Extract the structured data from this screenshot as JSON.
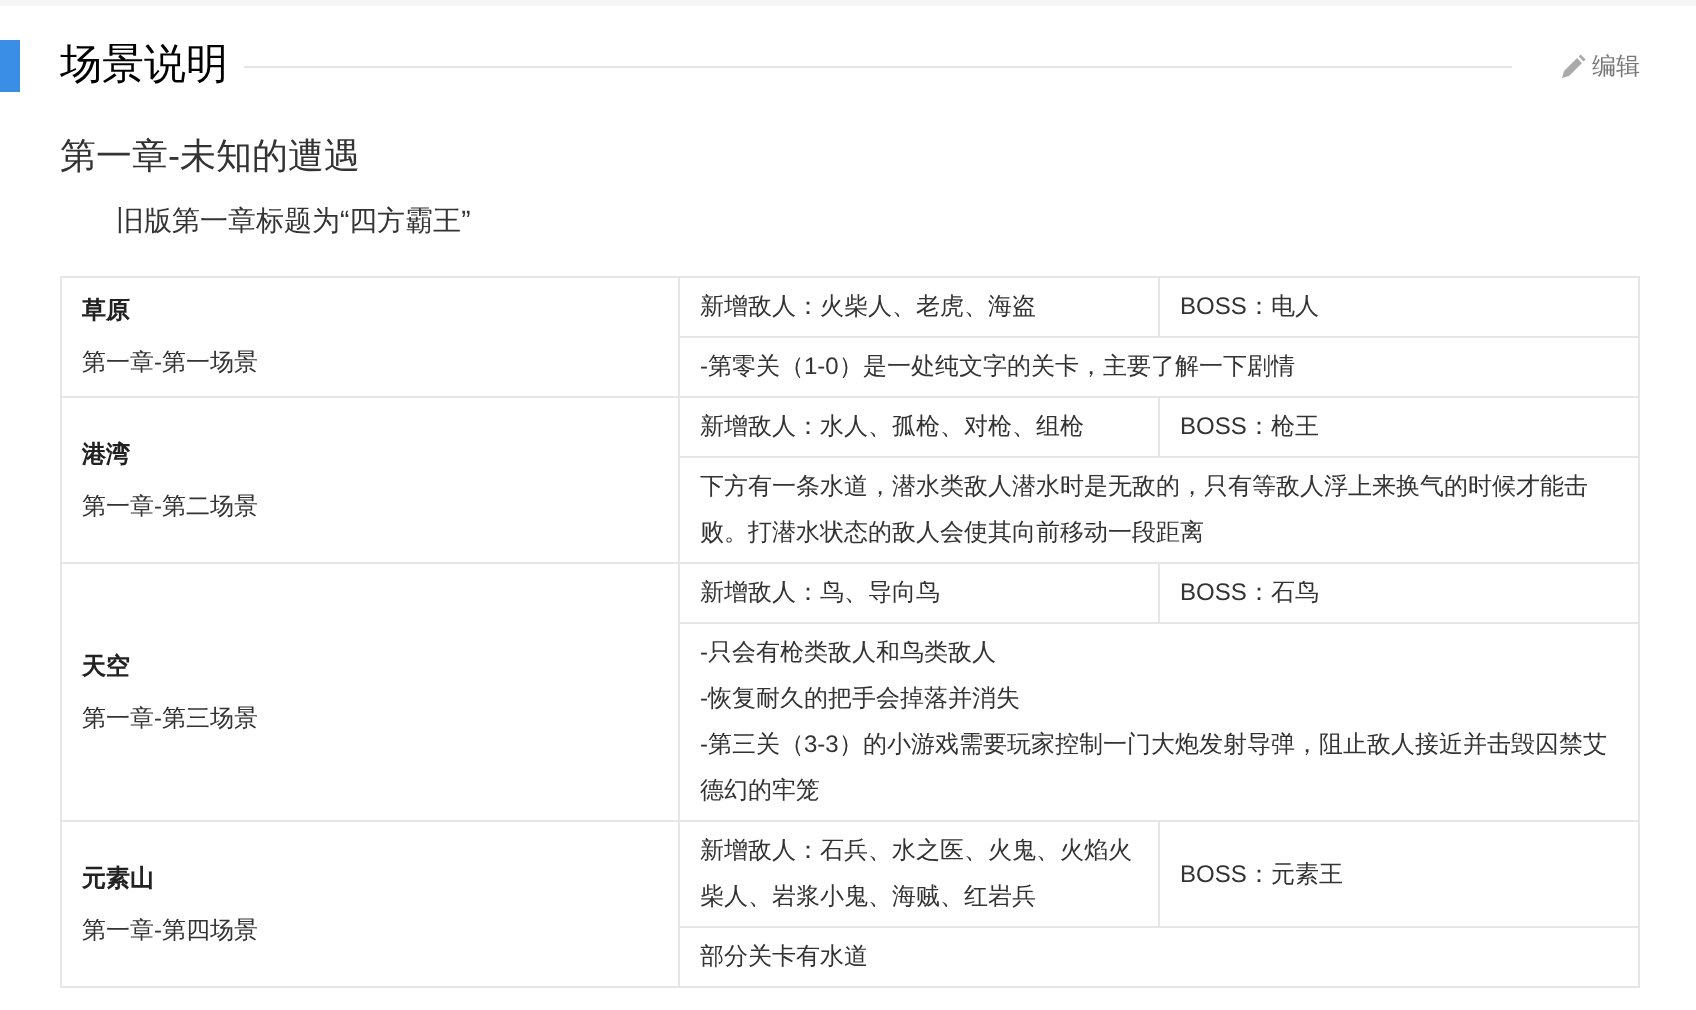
{
  "section": {
    "title": "场景说明",
    "edit_label": "编辑"
  },
  "chapter": {
    "title": "第一章-未知的遭遇",
    "note": "旧版第一章标题为“四方霸王”"
  },
  "scenes": [
    {
      "name": "草原",
      "subtitle": "第一章-第一场景",
      "enemies": "新增敌人：火柴人、老虎、海盗",
      "boss": "BOSS：电人",
      "notes": [
        "-第零关（1-0）是一处纯文字的关卡，主要了解一下剧情"
      ]
    },
    {
      "name": "港湾",
      "subtitle": "第一章-第二场景",
      "enemies": "新增敌人：水人、孤枪、对枪、组枪",
      "boss": "BOSS：枪王",
      "notes": [
        "下方有一条水道，潜水类敌人潜水时是无敌的，只有等敌人浮上来换气的时候才能击败。打潜水状态的敌人会使其向前移动一段距离"
      ]
    },
    {
      "name": "天空",
      "subtitle": "第一章-第三场景",
      "enemies": "新增敌人：鸟、导向鸟",
      "boss": "BOSS：石鸟",
      "notes": [
        "-只会有枪类敌人和鸟类敌人",
        "-恢复耐久的把手会掉落并消失",
        "-第三关（3-3）的小游戏需要玩家控制一门大炮发射导弹，阻止敌人接近并击毁囚禁艾德幻的牢笼"
      ]
    },
    {
      "name": "元素山",
      "subtitle": "第一章-第四场景",
      "enemies": "新增敌人：石兵、水之医、火鬼、火焰火柴人、岩浆小鬼、海贼、红岩兵",
      "boss": "BOSS：元素王",
      "notes": [
        "部分关卡有水道"
      ]
    }
  ]
}
